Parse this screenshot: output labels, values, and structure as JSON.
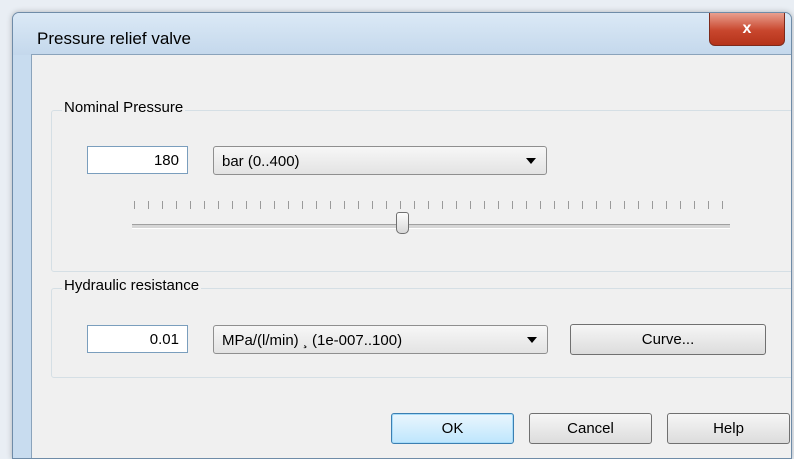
{
  "window": {
    "title": "Pressure relief valve",
    "close_label": "x"
  },
  "nominal_pressure": {
    "group_label": "Nominal Pressure",
    "value": "180",
    "unit": "bar  (0..400)",
    "slider": {
      "min": 0,
      "max": 400,
      "value": 180
    }
  },
  "hydraulic_resistance": {
    "group_label": "Hydraulic resistance",
    "value": "0.01",
    "unit": "MPa/(l/min) ¸ (1e-007..100)",
    "curve_button": "Curve..."
  },
  "buttons": {
    "ok": "OK",
    "cancel": "Cancel",
    "help": "Help"
  },
  "colors": {
    "close_button": "#c8462d",
    "title_bar": "#c8dcef",
    "default_button": "#bee6fd"
  }
}
